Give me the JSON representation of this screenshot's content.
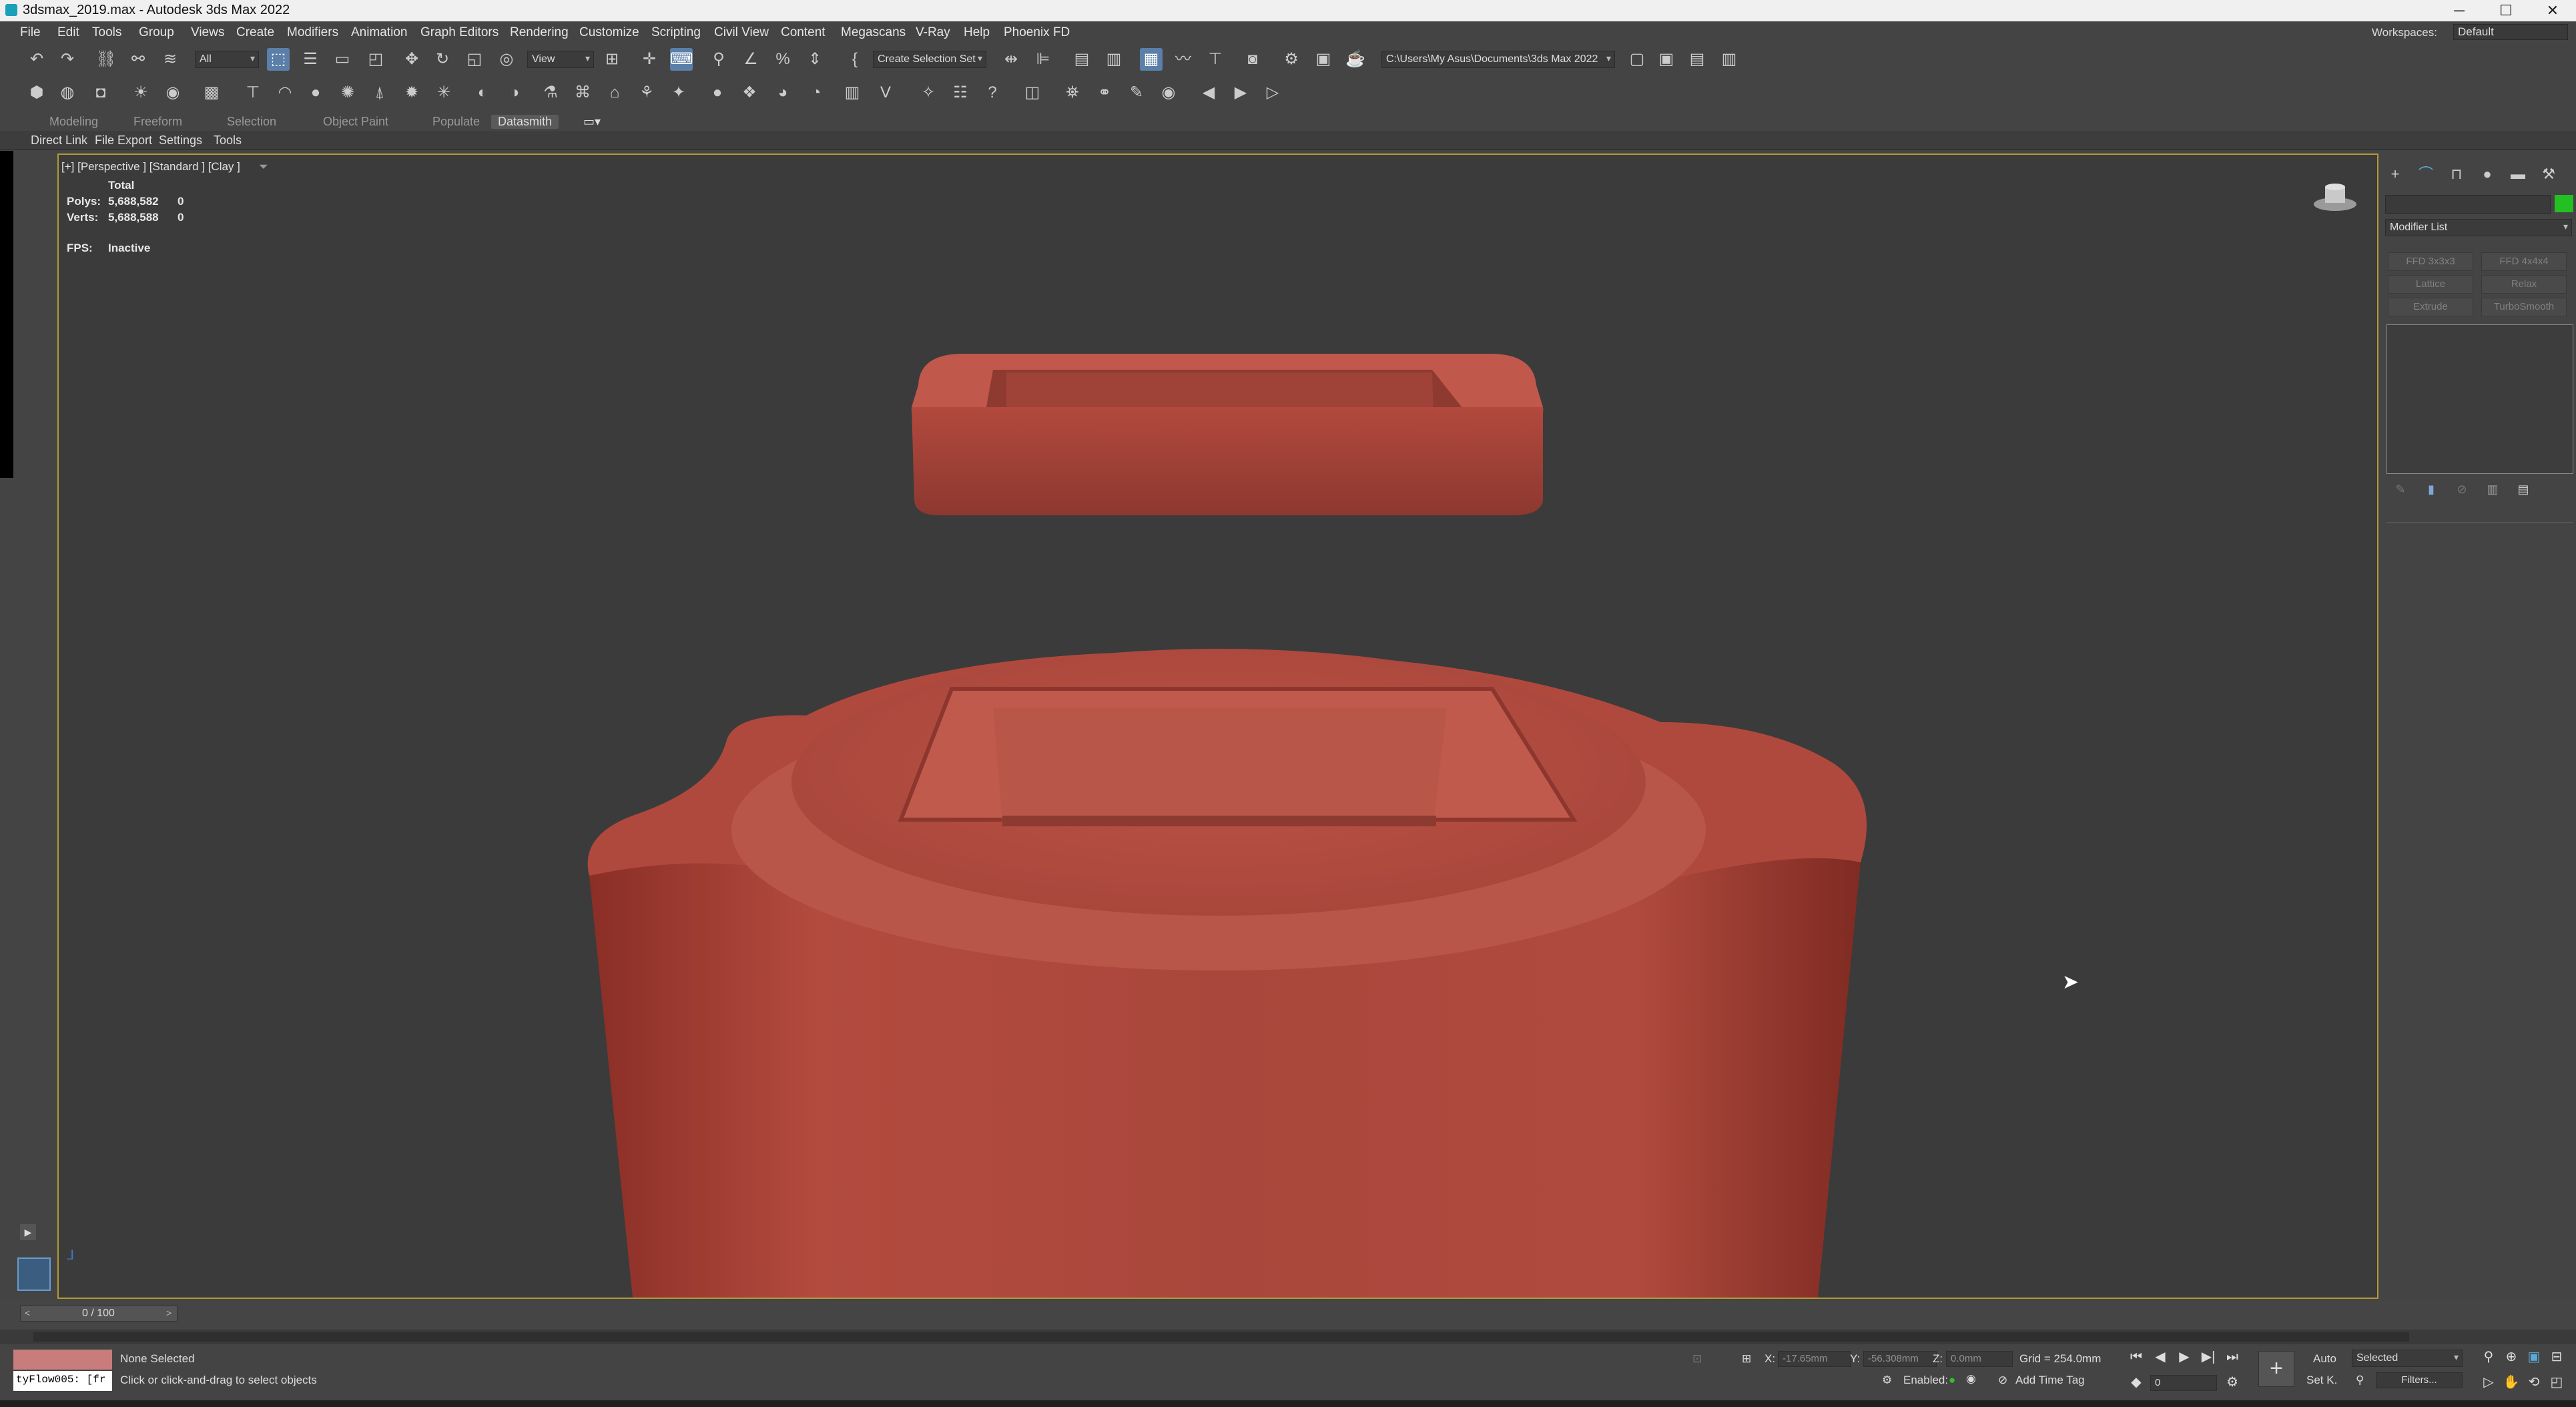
{
  "window": {
    "title": "3dsmax_2019.max - Autodesk 3ds Max 2022",
    "min_glyph": "─",
    "max_glyph": "☐",
    "close_glyph": "✕"
  },
  "menubar": {
    "items": [
      "File",
      "Edit",
      "Tools",
      "Group",
      "Views",
      "Create",
      "Modifiers",
      "Animation",
      "Graph Editors",
      "Rendering",
      "Customize",
      "Scripting",
      "Civil View",
      "Content",
      "Megascans",
      "V-Ray",
      "Help",
      "Phoenix FD"
    ],
    "workspace_label": "Workspaces:",
    "workspace_value": "Default"
  },
  "toolbar": {
    "selection_filter": "All",
    "ref_coord": "View",
    "selection_set_placeholder": "Create Selection Set",
    "project_path": "C:\\Users\\My Asus\\Documents\\3ds Max 2022"
  },
  "ribbon": {
    "tabs": [
      "Modeling",
      "Freeform",
      "Selection",
      "Object Paint",
      "Populate",
      "Datasmith"
    ],
    "active_tab": "Datasmith",
    "subtabs": [
      "Direct Link",
      "File Export",
      "Settings",
      "Tools"
    ]
  },
  "viewport": {
    "label": "[+] [Perspective ] [Standard ] [Clay ]",
    "stats": {
      "total_label": "Total",
      "polys_label": "Polys:",
      "polys_value": "5,688,582",
      "polys_sel": "0",
      "verts_label": "Verts:",
      "verts_value": "5,688,588",
      "verts_sel": "0",
      "fps_label": "FPS:",
      "fps_value": "Inactive"
    },
    "object_color": "#b54a3d",
    "active_border_color": "#b39a35"
  },
  "command_panel": {
    "modifier_list_label": "Modifier List",
    "buttons": [
      "FFD 3x3x3",
      "FFD 4x4x4",
      "Lattice",
      "Relax",
      "Extrude",
      "TurboSmooth"
    ],
    "color_swatch": "#22c022"
  },
  "timeline": {
    "frame_label": "0 / 100"
  },
  "status": {
    "script_listener": "tyFlow005: [fr",
    "selection_status": "None Selected",
    "prompt": "Click or click-and-drag to select objects",
    "x_label": "X:",
    "x_value": "-17.65mm",
    "y_label": "Y:",
    "y_value": "-56.308mm",
    "z_label": "Z:",
    "z_value": "0.0mm",
    "grid": "Grid = 254.0mm",
    "enabled_label": "Enabled:",
    "add_time_tag": "Add Time Tag",
    "auto_label": "Auto",
    "selected_dropdown": "Selected",
    "set_key_label": "Set K.",
    "filters_label": "Filters...",
    "frame_field": "0"
  }
}
